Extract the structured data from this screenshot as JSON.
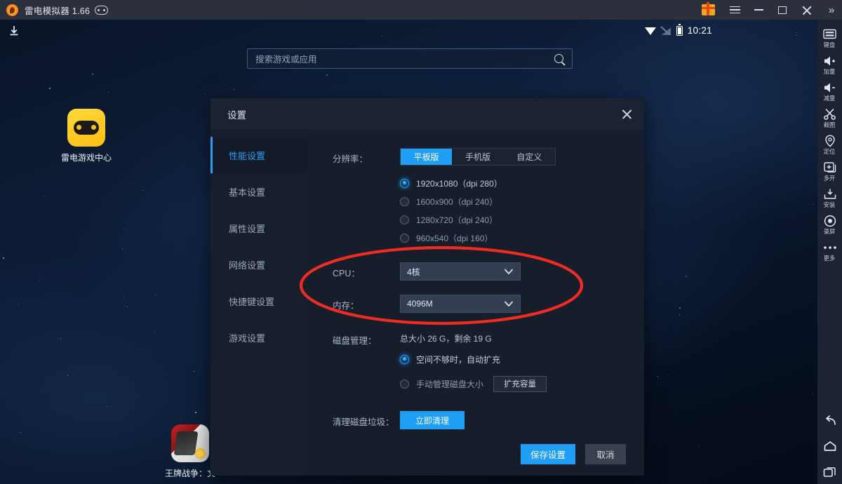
{
  "window": {
    "title": "雷电模拟器 1.66",
    "logo_icon": "ldplayer-logo-icon",
    "version_badge_icon": "sync-badge-icon",
    "gift_icon": "gift-icon",
    "menu_icon": "hamburger-menu-icon",
    "minimize_icon": "minimize-icon",
    "maximize_icon": "maximize-icon",
    "close_icon": "close-icon",
    "collapse_icon": "double-chevron-right-icon"
  },
  "android_status": {
    "download_icon": "download-icon",
    "wifi_icon": "wifi-icon",
    "signal_icon": "signal-off-icon",
    "battery_icon": "battery-icon",
    "time": "10:21"
  },
  "search": {
    "placeholder": "搜索游戏或应用",
    "value": "",
    "icon": "search-icon"
  },
  "desktop": {
    "icons": [
      {
        "label": "雷电游戏中心",
        "icon": "gamepad-icon"
      },
      {
        "label": "王牌战争：文",
        "icon": "game-war-icon"
      }
    ]
  },
  "toolbar": {
    "items": [
      {
        "label": "键盘",
        "icon": "keyboard-icon"
      },
      {
        "label": "加量",
        "icon": "volume-up-icon"
      },
      {
        "label": "减量",
        "icon": "volume-down-icon"
      },
      {
        "label": "截图",
        "icon": "scissors-icon"
      },
      {
        "label": "定位",
        "icon": "location-pin-icon"
      },
      {
        "label": "多开",
        "icon": "multi-instance-icon"
      },
      {
        "label": "安装",
        "icon": "install-apk-icon"
      },
      {
        "label": "录屏",
        "icon": "record-icon"
      },
      {
        "label": "更多",
        "icon": "more-dots-icon"
      }
    ],
    "nav": [
      {
        "label": "返回",
        "icon": "back-icon"
      },
      {
        "label": "主页",
        "icon": "home-icon"
      },
      {
        "label": "多任务",
        "icon": "recent-apps-icon"
      }
    ]
  },
  "dialog": {
    "title": "设置",
    "close_icon": "close-icon",
    "sidebar": [
      {
        "label": "性能设置",
        "active": true
      },
      {
        "label": "基本设置",
        "active": false
      },
      {
        "label": "属性设置",
        "active": false
      },
      {
        "label": "网络设置",
        "active": false
      },
      {
        "label": "快捷键设置",
        "active": false
      },
      {
        "label": "游戏设置",
        "active": false
      }
    ],
    "resolution": {
      "label": "分辨率：",
      "tabs": [
        {
          "label": "平板版",
          "selected": true
        },
        {
          "label": "手机版",
          "selected": false
        },
        {
          "label": "自定义",
          "selected": false
        }
      ],
      "options": [
        {
          "label": "1920x1080（dpi 280）",
          "selected": true
        },
        {
          "label": "1600x900（dpi 240）",
          "selected": false
        },
        {
          "label": "1280x720（dpi 240）",
          "selected": false
        },
        {
          "label": "960x540（dpi 160）",
          "selected": false
        }
      ]
    },
    "cpu": {
      "label": "CPU：",
      "value": "4核",
      "chevron_icon": "chevron-down-icon"
    },
    "memory": {
      "label": "内存：",
      "value": "4096M",
      "chevron_icon": "chevron-down-icon"
    },
    "disk": {
      "label": "磁盘管理：",
      "info": "总大小 26 G，剩余 19 G",
      "options": [
        {
          "label": "空间不够时，自动扩充",
          "selected": true
        },
        {
          "label": "手动管理磁盘大小",
          "selected": false
        }
      ],
      "expand_button": "扩充容量"
    },
    "cleanup": {
      "label": "清理磁盘垃圾：",
      "button": "立即清理"
    },
    "footer": {
      "save": "保存设置",
      "cancel": "取消"
    }
  },
  "annotation": {
    "shape": "red-ellipse-highlight",
    "color": "#ef2b22",
    "targets": [
      "CPU：",
      "内存："
    ]
  },
  "colors": {
    "accent": "#1f9ef5",
    "titlebar": "#2b303c",
    "dialog_bg": "#161d2b",
    "dialog_side": "#171e2c",
    "rail_bg": "#1c2334",
    "annotation_red": "#ef2b22"
  }
}
